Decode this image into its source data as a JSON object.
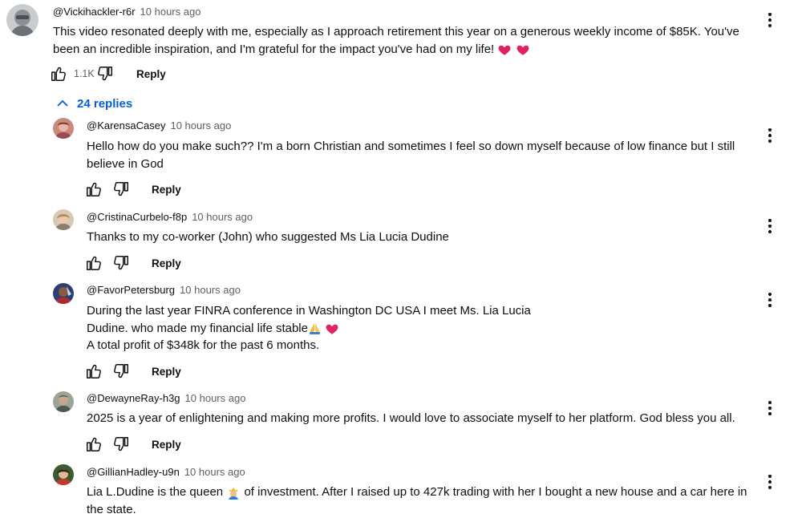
{
  "top_comment": {
    "author": "@Vickihackler-r6r",
    "time": "10 hours ago",
    "text": "This video resonated deeply with me, especially as I approach retirement this year on a generous weekly income of $85K. You've been an incredible inspiration, and I'm grateful for the impact you've had on my life! ",
    "like_count": "1.1K",
    "reply_label": "Reply"
  },
  "replies_toggle": {
    "label": "24 replies"
  },
  "replies": [
    {
      "author": "@KarensaCasey",
      "time": "10 hours ago",
      "text": "Hello how do you make such?? I'm a born Christian and sometimes I feel so down myself because of low finance but I still believe in God",
      "reply_label": "Reply"
    },
    {
      "author": "@CristinaCurbelo-f8p",
      "time": "10 hours ago",
      "text": "Thanks to my co-worker (John) who suggested Ms Lia Lucia Dudine",
      "reply_label": "Reply"
    },
    {
      "author": "@FavorPetersburg",
      "time": "10 hours ago",
      "line1": "During the last year FINRA conference in Washington DC USA I meet Ms. Lia Lucia",
      "line2": "Dudine. who made my financial life stable",
      "line3": "A total profit of $348k for the past 6 months.",
      "reply_label": "Reply"
    },
    {
      "author": "@DewayneRay-h3g",
      "time": "10 hours ago",
      "text": "2025 is a year of enlightening and making more profits. I would love to associate myself to her platform. God bless you all.",
      "reply_label": "Reply"
    },
    {
      "author": "@GillianHadley-u9n",
      "time": "10 hours ago",
      "text_before": "Lia L.Dudine is the queen ",
      "text_after": " of investment. After I raised up to 427k trading with her I bought a new house and a car here in the state."
    }
  ],
  "icons": {
    "like": "thumbs-up-icon",
    "dislike": "thumbs-down-icon",
    "menu": "more-vert-icon",
    "collapse": "chevron-up-icon",
    "heart": "red-heart-emoji",
    "pray": "folded-hands-emoji",
    "queen": "woman-with-crown-emoji"
  },
  "colors": {
    "link_blue": "#065fd4",
    "heart_red": "#e0245e",
    "secondary_text": "#606060"
  }
}
